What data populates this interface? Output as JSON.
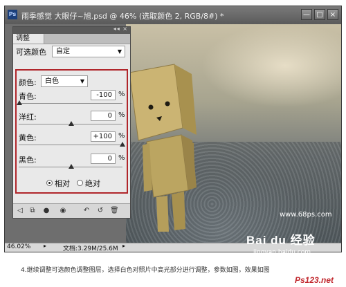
{
  "window": {
    "app_badge": "Ps",
    "title": "雨季感觉  大眼仔~旭.psd @ 46% (选取颜色 2, RGB/8#) *",
    "buttons": {
      "minimize": "—",
      "maximize": "□",
      "close": "×"
    }
  },
  "panel": {
    "tab_label": "调整",
    "collapse_glyph": "◂◂ ×",
    "adjustment_name": "可选颜色",
    "preset_value": "自定",
    "colors_label": "颜色:",
    "colors_value": "白色",
    "sliders": [
      {
        "label": "青色:",
        "value": "-100",
        "unit": "%",
        "level": -100
      },
      {
        "label": "洋红:",
        "value": "0",
        "unit": "%",
        "level": 0
      },
      {
        "label": "黄色:",
        "value": "+100",
        "unit": "%",
        "level": 100
      },
      {
        "label": "黑色:",
        "value": "0",
        "unit": "%",
        "level": 0
      }
    ],
    "method_relative": "相对",
    "method_absolute": "绝对",
    "method_selected": "relative",
    "toolbar_icons": [
      "back-arrow-icon",
      "clip-to-layer-icon",
      "visibility-icon",
      "eye-icon",
      "previous-state-icon",
      "reset-icon",
      "trash-icon"
    ]
  },
  "status": {
    "zoom": "46.02%",
    "doc_info": "文档:3.29M/25.6M"
  },
  "photo": {
    "watermark": "www.68ps.com"
  },
  "caption": "4.继续调整可选颜色调整图层，选择白色对照片中高光部分进行调整，参数如图，效果如图",
  "overlays": {
    "baidu_logo": "Bai du 经验",
    "baidu_sub": "jingyan.baidu.com",
    "ps123": "Ps123.net"
  },
  "colors": {
    "highlight_border": "#b0252a",
    "panel_bg": "#e9e9e9"
  }
}
